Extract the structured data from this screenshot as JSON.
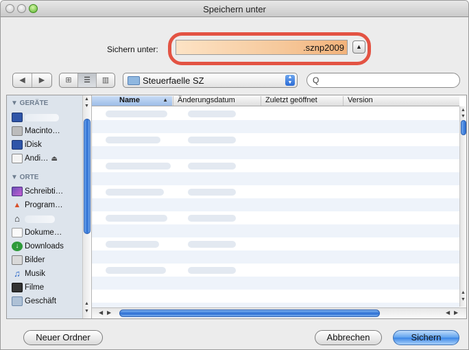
{
  "window": {
    "title": "Speichern unter"
  },
  "save": {
    "label": "Sichern unter:",
    "filename_suffix": ".sznp2009",
    "expand_glyph": "▲"
  },
  "toolbar": {
    "back_glyph": "◀",
    "forward_glyph": "▶",
    "view_icon": "⊞",
    "view_list": "☰",
    "view_columns": "▥",
    "location": "Steuerfaelle SZ",
    "search_placeholder": "",
    "search_glyph": "Q"
  },
  "sidebar": {
    "devices_header": "▼ GERÄTE",
    "places_header": "▼ ORTE",
    "devices": [
      {
        "label": "",
        "icon": "monitor-icon"
      },
      {
        "label": "Macinto…",
        "icon": "hard-drive-icon"
      },
      {
        "label": "iDisk",
        "icon": "idisk-icon"
      },
      {
        "label": "Andi…",
        "icon": "disk-icon",
        "eject": "⏏"
      }
    ],
    "places": [
      {
        "label": "Schreibti…",
        "icon": "desktop-icon"
      },
      {
        "label": "Program…",
        "icon": "applications-icon"
      },
      {
        "label": "",
        "icon": "home-icon"
      },
      {
        "label": "Dokume…",
        "icon": "documents-icon"
      },
      {
        "label": "Downloads",
        "icon": "downloads-icon"
      },
      {
        "label": "Bilder",
        "icon": "pictures-icon"
      },
      {
        "label": "Musik",
        "icon": "music-icon"
      },
      {
        "label": "Filme",
        "icon": "movies-icon"
      },
      {
        "label": "Geschäft",
        "icon": "folder-icon"
      }
    ]
  },
  "list": {
    "columns": [
      "Name",
      "Änderungsdatum",
      "Zuletzt geöffnet",
      "Version"
    ],
    "sorted_column": "Name",
    "sort_glyph": "▲"
  },
  "buttons": {
    "new_folder": "Neuer Ordner",
    "cancel": "Abbrechen",
    "save": "Sichern"
  },
  "colors": {
    "highlight": "#e35343",
    "accent": "#2c6fd3"
  }
}
